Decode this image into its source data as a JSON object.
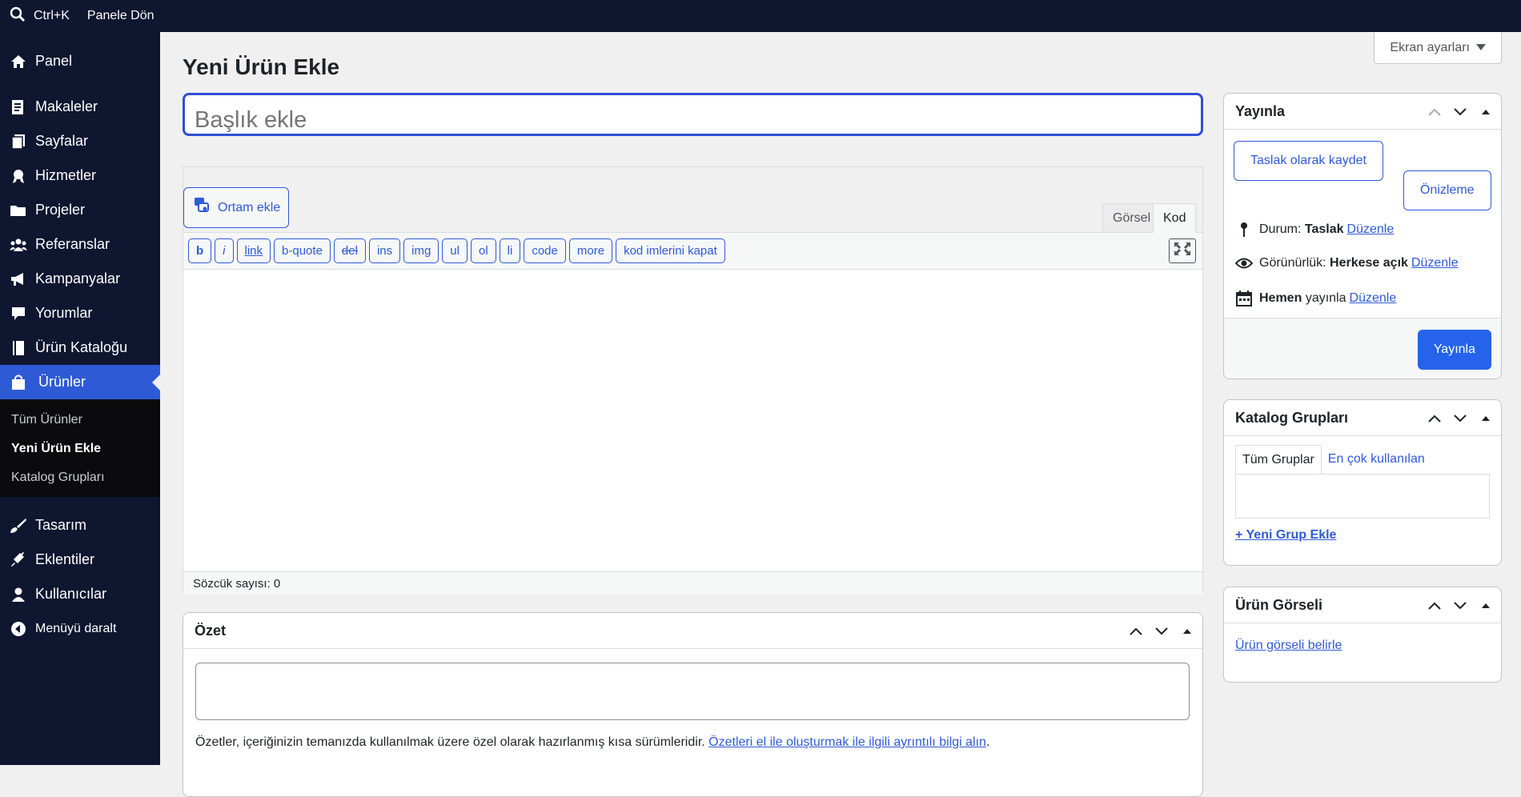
{
  "topbar": {
    "shortcut": "Ctrl+K",
    "back_label": "Panele Dön"
  },
  "sidebar": {
    "items": [
      {
        "label": "Panel",
        "icon": "home-icon"
      },
      {
        "label": "Makaleler",
        "icon": "post-icon"
      },
      {
        "label": "Sayfalar",
        "icon": "pages-icon"
      },
      {
        "label": "Hizmetler",
        "icon": "award-icon"
      },
      {
        "label": "Projeler",
        "icon": "folder-icon"
      },
      {
        "label": "Referanslar",
        "icon": "groups-icon"
      },
      {
        "label": "Kampanyalar",
        "icon": "megaphone-icon"
      },
      {
        "label": "Yorumlar",
        "icon": "comment-icon"
      },
      {
        "label": "Ürün Kataloğu",
        "icon": "book-icon"
      },
      {
        "label": "Ürünler",
        "icon": "bag-icon"
      },
      {
        "label": "Tasarım",
        "icon": "brush-icon"
      },
      {
        "label": "Eklentiler",
        "icon": "plugin-icon"
      },
      {
        "label": "Kullanıcılar",
        "icon": "user-icon"
      },
      {
        "label": "Menüyü daralt",
        "icon": "collapse-icon"
      }
    ],
    "submenu": [
      "Tüm Ürünler",
      "Yeni Ürün Ekle",
      "Katalog Grupları"
    ]
  },
  "main": {
    "screen_options": "Ekran ayarları",
    "page_title": "Yeni Ürün Ekle",
    "title_placeholder": "Başlık ekle"
  },
  "editor": {
    "add_media": "Ortam ekle",
    "tab_visual": "Görsel",
    "tab_code": "Kod",
    "quicktags": [
      "b",
      "i",
      "link",
      "b-quote",
      "del",
      "ins",
      "img",
      "ul",
      "ol",
      "li",
      "code",
      "more",
      "kod imlerini kapat"
    ],
    "word_count": "Sözcük sayısı: 0"
  },
  "excerpt": {
    "title": "Özet",
    "description": "Özetler, içeriğinizin temanızda kullanılmak üzere özel olarak hazırlanmış kısa sürümleridir.",
    "link": "Özetleri el ile oluşturmak ile ilgili ayrıntılı bilgi alın",
    "link_suffix": "."
  },
  "publish": {
    "title": "Yayınla",
    "save_draft": "Taslak olarak kaydet",
    "preview": "Önizleme",
    "status_label": "Durum:",
    "status_value": "Taslak",
    "visibility_label": "Görünürlük:",
    "visibility_value": "Herkese açık",
    "schedule_bold": "Hemen",
    "schedule_rest": "yayınla",
    "edit": "Düzenle",
    "publish_button": "Yayınla"
  },
  "catalog_groups": {
    "title": "Katalog Grupları",
    "tab_all": "Tüm Gruplar",
    "tab_popular": "En çok kullanılan",
    "add_new": "+ Yeni Grup Ekle"
  },
  "product_image": {
    "title": "Ürün Görseli",
    "set_image": "Ürün görseli belirle"
  },
  "colors": {
    "accent": "#2f5ad6",
    "sidebar_bg": "#0e1630",
    "primary_button": "#2563eb"
  }
}
